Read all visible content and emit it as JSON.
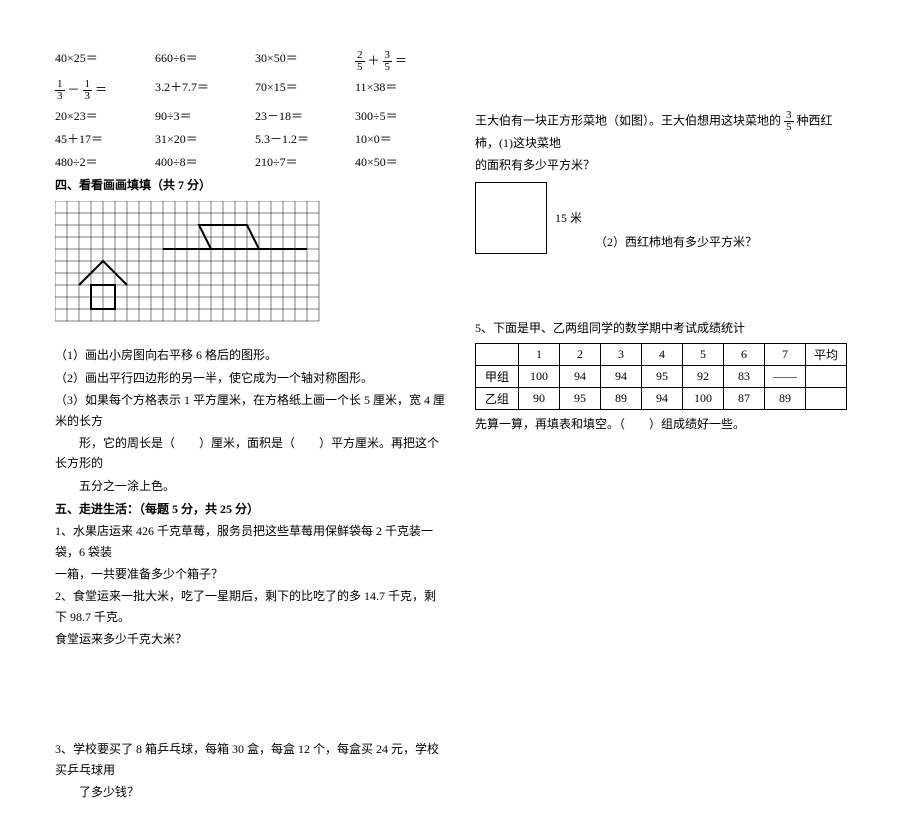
{
  "calc": {
    "r1c1": "40×25＝",
    "r1c2": "660÷6＝",
    "r1c3": "30×50＝",
    "r1c4_a": "2",
    "r1c4_b": "5",
    "r1c4_c": "3",
    "r1c4_d": "5",
    "r2c1_a": "1",
    "r2c1_b": "3",
    "r2c1_c": "1",
    "r2c1_d": "3",
    "r2c2": "3.2＋7.7＝",
    "r2c3": "70×15＝",
    "r2c4": "11×38＝",
    "r3c1": "20×23＝",
    "r3c2": "90÷3＝",
    "r3c3": "23－18＝",
    "r3c4": "300÷5＝",
    "r4c1": "45＋17＝",
    "r4c2": "31×20＝",
    "r4c3": "5.3－1.2＝",
    "r4c4": "10×0＝",
    "r5c1": "480÷2＝",
    "r5c2": "400÷8＝",
    "r5c3": "210÷7＝",
    "r5c4": "40×50＝"
  },
  "sec4": {
    "title": "四、看看画画填填（共 7 分）",
    "q1": "（1）画出小房图向右平移 6 格后的图形。",
    "q2": "（2）画出平行四边形的另一半，使它成为一个轴对称图形。",
    "q3a": "（3）如果每个方格表示 1 平方厘米，在方格纸上画一个长 5 厘米，宽 4 厘米的长方",
    "q3b": "形，它的周长是（　　）厘米，面积是（　　）平方厘米。再把这个长方形的",
    "q3c": "五分之一涂上色。"
  },
  "sec5": {
    "title": "五、走进生活：（每题 5 分，共 25 分）",
    "q1a": "1、水果店运来 426 千克草莓，服务员把这些草莓用保鲜袋每 2 千克装一袋，6 袋装",
    "q1b": "一箱，一共要准备多少个箱子？",
    "q2a": "2、食堂运来一批大米，吃了一星期后，剩下的比吃了的多 14.7 千克，剩下 98.7 千克。",
    "q2b": "食堂运来多少千克大米？",
    "q3a": "3、学校要买了 8 箱乒乓球，每箱 30 盒，每盒 12 个，每盒买 24 元，学校买乒乓球用",
    "q3b": "了多少钱？"
  },
  "right": {
    "intro_a": "王大伯有一块正方形菜地（如图）。王大伯想用这块菜地的",
    "intro_frac_n": "3",
    "intro_frac_d": "5",
    "intro_b": "种西红柿，(1)这块菜地",
    "intro_c": "的面积有多少平方米？",
    "side": "15 米",
    "q2": "（2）西红柿地有多少平方米？",
    "q5_title": "5、下面是甲、乙两组同学的数学期中考试成绩统计",
    "table": {
      "head": [
        "",
        "1",
        "2",
        "3",
        "4",
        "5",
        "6",
        "7",
        "平均"
      ],
      "rowA": [
        "甲组",
        "100",
        "94",
        "94",
        "95",
        "92",
        "83",
        "——",
        ""
      ],
      "rowB": [
        "乙组",
        "90",
        "95",
        "89",
        "94",
        "100",
        "87",
        "89",
        ""
      ]
    },
    "q5_tail": "先算一算，再填表和填空。（　　）组成绩好一些。"
  }
}
